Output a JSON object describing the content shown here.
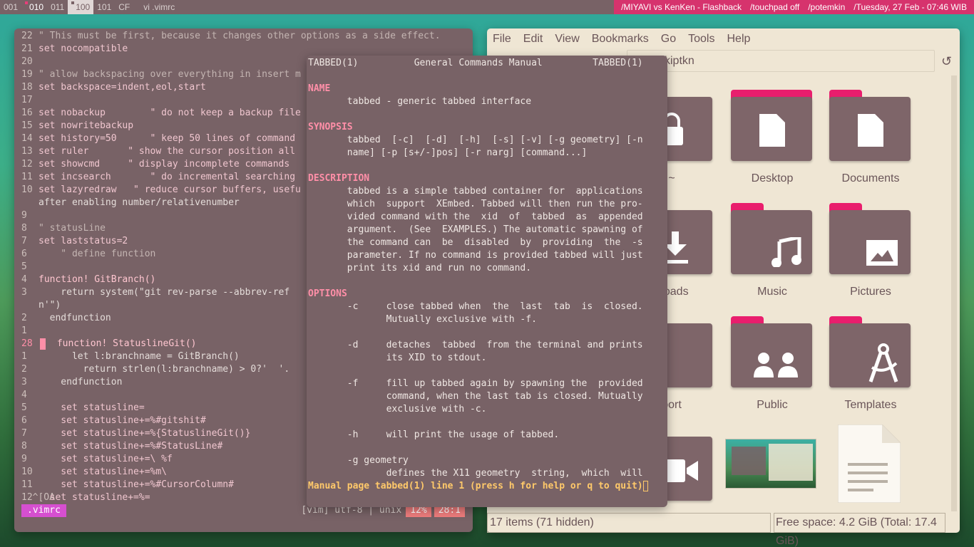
{
  "topbar": {
    "workspaces": [
      {
        "label": "001",
        "state": "normal"
      },
      {
        "label": "010",
        "state": "urgent"
      },
      {
        "label": "011",
        "state": "normal"
      },
      {
        "label": "100",
        "state": "active"
      },
      {
        "label": "101",
        "state": "normal"
      },
      {
        "label": "CF",
        "state": "normal"
      }
    ],
    "window_title": "vi .vimrc",
    "status": [
      "/MIYAVI vs KenKen - Flashback",
      "/touchpad off",
      "/potemkin",
      "/Tuesday, 27 Feb - 07:46 WIB"
    ]
  },
  "vim": {
    "lines": [
      {
        "n": "22",
        "t": "\" This must be first, because it changes other options as a side effect."
      },
      {
        "n": "21",
        "t": "set nocompatible"
      },
      {
        "n": "20",
        "t": ""
      },
      {
        "n": "19",
        "t": "\" allow backspacing over everything in insert m"
      },
      {
        "n": "18",
        "t": "set backspace=indent,eol,start"
      },
      {
        "n": "17",
        "t": ""
      },
      {
        "n": "16",
        "t": "set nobackup        \" do not keep a backup file"
      },
      {
        "n": "15",
        "t": "set nowritebackup"
      },
      {
        "n": "14",
        "t": "set history=50      \" keep 50 lines of command"
      },
      {
        "n": "13",
        "t": "set ruler       \" show the cursor position all"
      },
      {
        "n": "12",
        "t": "set showcmd     \" display incomplete commands"
      },
      {
        "n": "11",
        "t": "set incsearch       \" do incremental searching"
      },
      {
        "n": "10",
        "t": "set lazyredraw   \" reduce cursor buffers, usefu"
      },
      {
        "n": "",
        "t": "after enabling number/relativenumber"
      },
      {
        "n": "9",
        "t": ""
      },
      {
        "n": "8",
        "t": "\" statusLine"
      },
      {
        "n": "7",
        "t": "set laststatus=2"
      },
      {
        "n": "6",
        "t": "    \" define function"
      },
      {
        "n": "5",
        "t": ""
      },
      {
        "n": "4",
        "t": "function! GitBranch()"
      },
      {
        "n": "3",
        "t": "    return system(\"git rev-parse --abbrev-ref"
      },
      {
        "n": "",
        "t": "n'\")"
      },
      {
        "n": "2",
        "t": "  endfunction"
      },
      {
        "n": "1",
        "t": ""
      },
      {
        "n": "28",
        "t": " function! StatuslineGit()"
      },
      {
        "n": "1",
        "t": "      let l:branchname = GitBranch()"
      },
      {
        "n": "2",
        "t": "        return strlen(l:branchname) > 0?'  '."
      },
      {
        "n": "3",
        "t": "    endfunction"
      },
      {
        "n": "4",
        "t": ""
      },
      {
        "n": "5",
        "t": "    set statusline="
      },
      {
        "n": "6",
        "t": "    set statusline+=%#gitshit#"
      },
      {
        "n": "7",
        "t": "    set statusline+=%{StatuslineGit()}"
      },
      {
        "n": "8",
        "t": "    set statusline+=%#StatusLine#"
      },
      {
        "n": "9",
        "t": "    set statusline+=\\ %f"
      },
      {
        "n": "10",
        "t": "    set statusline+=%m\\"
      },
      {
        "n": "11",
        "t": "    set statusline+=%#CursorColumn#"
      },
      {
        "n": "12^[OA",
        "t": "  set statusline+=%="
      }
    ],
    "status": {
      "file": ".vimrc",
      "info": "[vim] utf-8 | unix",
      "percent": "12%",
      "position": "28:1"
    }
  },
  "man": {
    "header": "TABBED(1)          General Commands Manual         TABBED(1)",
    "name_h": "NAME",
    "name_t": "       tabbed - generic tabbed interface",
    "synopsis_h": "SYNOPSIS",
    "syn1": "       tabbed  [-c]  [-d]  [-h]  [-s] [-v] [-g geometry] [-n",
    "syn2": "       name] [-p [s+/-]pos] [-r narg] [command...]",
    "desc_h": "DESCRIPTION",
    "desc": [
      "       tabbed is a simple tabbed container for  applications",
      "       which  support  XEmbed. Tabbed will then run the pro-",
      "       vided command with the  xid  of  tabbed  as  appended",
      "       argument.  (See  EXAMPLES.) The automatic spawning of",
      "       the command can  be  disabled  by  providing  the  -s",
      "       parameter. If no command is provided tabbed will just",
      "       print its xid and run no command."
    ],
    "opt_h": "OPTIONS",
    "opts": [
      "       -c     close tabbed when  the  last  tab  is  closed.",
      "              Mutually exclusive with -f.",
      "",
      "       -d     detaches  tabbed  from the terminal and prints",
      "              its XID to stdout.",
      "",
      "       -f     fill up tabbed again by spawning the  provided",
      "              command, when the last tab is closed. Mutually",
      "              exclusive with -c.",
      "",
      "       -h     will print the usage of tabbed.",
      "",
      "       -g geometry",
      "              defines the X11 geometry  string,  which  will"
    ],
    "prompt": "Manual page tabbed(1) line 1 (press h for help or q to quit)"
  },
  "filemanager": {
    "menu": [
      "File",
      "Edit",
      "View",
      "Bookmarks",
      "Go",
      "Tools",
      "Help"
    ],
    "path": "kiptkn",
    "items": [
      {
        "label": "~",
        "icon": "lock-icon"
      },
      {
        "label": "Desktop",
        "icon": "document-icon"
      },
      {
        "label": "Documents",
        "icon": "document-icon"
      },
      {
        "label": "nloads",
        "icon": "download-icon"
      },
      {
        "label": "Music",
        "icon": "music-icon"
      },
      {
        "label": "Pictures",
        "icon": "image-icon"
      },
      {
        "label": "port",
        "icon": "folder-icon"
      },
      {
        "label": "Public",
        "icon": "people-icon"
      },
      {
        "label": "Templates",
        "icon": "compass-icon"
      }
    ],
    "status_left": "17 items (71 hidden)",
    "status_right": "Free space: 4.2 GiB (Total: 17.4 GiB)"
  },
  "colors": {
    "accent": "#e91e6d",
    "window_bg": "#786266",
    "fm_bg": "#efe6d4"
  }
}
